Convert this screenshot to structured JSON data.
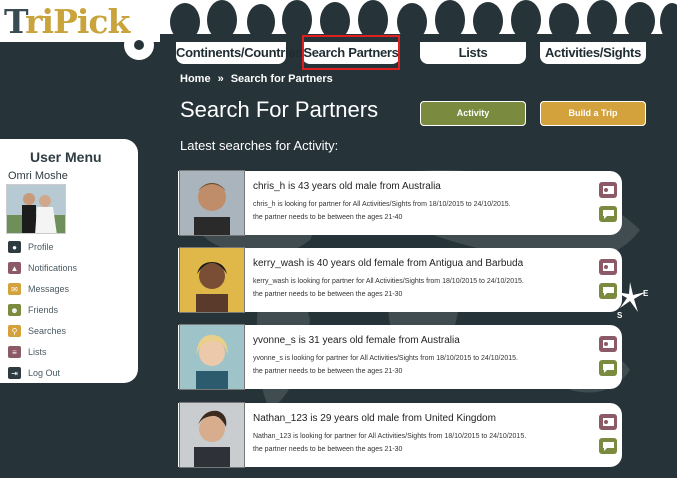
{
  "logo": {
    "first": "T",
    "rest": "riPick"
  },
  "nav": {
    "tabs": [
      "Continents/Countries",
      "Search Partners",
      "Lists",
      "Activities/Sights"
    ]
  },
  "breadcrumb": {
    "home": "Home",
    "separator": "»",
    "current": "Search for Partners"
  },
  "page": {
    "title": "Search For Partners",
    "section_label": "Latest searches for Activity:"
  },
  "buttons": {
    "activity": "Activity",
    "build_trip": "Build a Trip"
  },
  "sidebar": {
    "title": "User Menu",
    "user_name": "Omri Moshe",
    "items": [
      {
        "label": "Profile",
        "icon": "profile-icon",
        "color": "#2e3c42"
      },
      {
        "label": "Notifications",
        "icon": "notifications-icon",
        "color": "#8b5a66"
      },
      {
        "label": "Messages",
        "icon": "messages-icon",
        "color": "#d4a23c"
      },
      {
        "label": "Friends",
        "icon": "friends-icon",
        "color": "#7a8a3e"
      },
      {
        "label": "Searches",
        "icon": "searches-icon",
        "color": "#d4a23c"
      },
      {
        "label": "Lists",
        "icon": "lists-icon",
        "color": "#8b5a66"
      },
      {
        "label": "Log Out",
        "icon": "logout-icon",
        "color": "#2e3c42"
      }
    ]
  },
  "results": [
    {
      "headline": "chris_h is 43 years old male from Australia",
      "line1": "chris_h is looking for partner for All Activities/Sights from 18/10/2015 to 24/10/2015.",
      "line2": "the partner needs to be between the ages 21-40"
    },
    {
      "headline": "kerry_wash is 40 years old female from Antigua and Barbuda",
      "line1": "kerry_wash is looking for partner for All Activities/Sights from 18/10/2015 to 24/10/2015.",
      "line2": "the partner needs to be between the ages 21-30"
    },
    {
      "headline": "yvonne_s is 31 years old female from Australia",
      "line1": "yvonne_s is looking for partner for All Activities/Sights from 18/10/2015 to 24/10/2015.",
      "line2": "the partner needs to be between the ages 21-30"
    },
    {
      "headline": "Nathan_123 is 29 years old male from United Kingdom",
      "line1": "Nathan_123 is looking for partner for All Activities/Sights from 18/10/2015 to 24/10/2015.",
      "line2": "the partner needs to be between the ages 21-30"
    }
  ],
  "compass": {
    "east": "E",
    "south": "S"
  },
  "colors": {
    "background": "#263338",
    "olive": "#7a8a3e",
    "gold": "#d4a23c",
    "mauve": "#8b5a66"
  }
}
